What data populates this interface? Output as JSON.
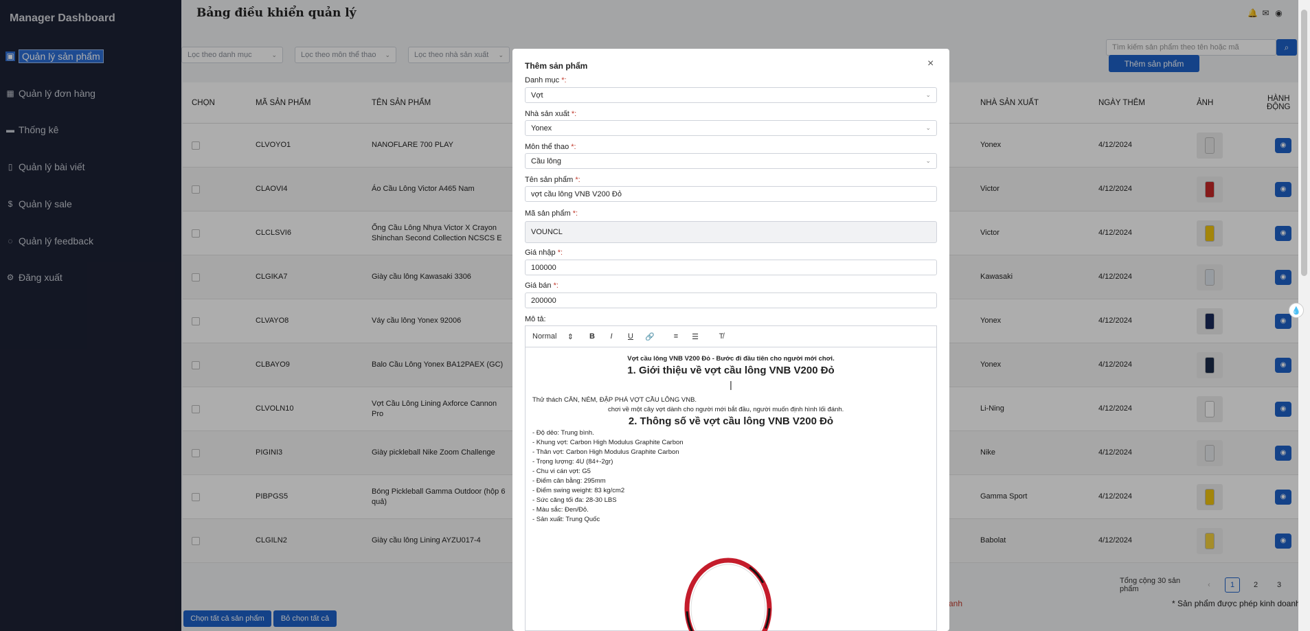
{
  "sidebar": {
    "brand": "Manager Dashboard",
    "items": [
      {
        "label": "Quản lý sản phẩm",
        "icon": "box-icon"
      },
      {
        "label": "Quản lý đơn hàng",
        "icon": "grid-icon"
      },
      {
        "label": "Thống kê",
        "icon": "chart-icon"
      },
      {
        "label": "Quản lý bài viết",
        "icon": "document-icon"
      },
      {
        "label": "Quản lý sale",
        "icon": "dollar-icon"
      },
      {
        "label": "Quản lý feedback",
        "icon": "comment-icon"
      },
      {
        "label": "Đăng xuất",
        "icon": "gear-icon"
      }
    ]
  },
  "header": {
    "title": "Bảng điều khiển quản lý"
  },
  "filters": {
    "category_placeholder": "Lọc theo danh mục",
    "sport_placeholder": "Lọc theo môn thể thao",
    "maker_placeholder": "Lọc theo nhà sản xuất"
  },
  "search": {
    "placeholder": "Tìm kiếm sản phẩm theo tên hoặc mã",
    "add_label": "Thêm sản phẩm"
  },
  "table": {
    "headers": {
      "select": "CHỌN",
      "code": "MÃ SẢN PHẨM",
      "name": "TÊN SẢN PHẨM",
      "maker": "NHÀ SẢN XUẤT",
      "date": "NGÀY THÊM",
      "image": "ẢNH",
      "action_1": "HÀNH",
      "action_2": "ĐỘNG"
    },
    "rows": [
      {
        "code": "CLVOYO1",
        "name": "NANOFLARE 700 PLAY",
        "maker": "Yonex",
        "date": "4/12/2024"
      },
      {
        "code": "CLAOVI4",
        "name": "Áo Cầu Lông Victor A465 Nam",
        "maker": "Victor",
        "date": "4/12/2024"
      },
      {
        "code": "CLCLSVI6",
        "name": "Ống Cầu Lông Nhựa Victor X Crayon Shinchan Second Collection NCSCS E",
        "maker": "Victor",
        "date": "4/12/2024"
      },
      {
        "code": "CLGIKA7",
        "name": "Giày cầu lông Kawasaki 3306",
        "maker": "Kawasaki",
        "date": "4/12/2024"
      },
      {
        "code": "CLVAYO8",
        "name": "Váy cầu lông Yonex 92006",
        "maker": "Yonex",
        "date": "4/12/2024"
      },
      {
        "code": "CLBAYO9",
        "name": "Balo Cầu Lông Yonex BA12PAEX (GC)",
        "maker": "Yonex",
        "date": "4/12/2024"
      },
      {
        "code": "CLVOLN10",
        "name": "Vợt Cầu Lông Lining Axforce Cannon Pro",
        "maker": "Li-Ning",
        "date": "4/12/2024"
      },
      {
        "code": "PIGINI3",
        "name": "Giày pickleball Nike Zoom Challenge",
        "maker": "Nike",
        "date": "4/12/2024"
      },
      {
        "code": "PIBPGS5",
        "name": "Bóng Pickleball Gamma Outdoor (hộp 6 quả)",
        "maker": "Gamma Sport",
        "date": "4/12/2024"
      },
      {
        "code": "CLGILN2",
        "name": "Giày cầu lông Lining AYZU017-4",
        "maker": "Babolat",
        "date": "4/12/2024"
      }
    ]
  },
  "pagination": {
    "total": "Tổng cộng 30 sản phẩm",
    "prev": "‹",
    "pages": [
      "1",
      "2",
      "3"
    ],
    "next": "›"
  },
  "notes": {
    "red": "anh",
    "right": "* Sản phẩm được phép kinh doanh"
  },
  "bottom": {
    "select_all": "Chọn tất cả sản phẩm",
    "deselect_all": "Bỏ chọn tất cả"
  },
  "modal": {
    "title": "Thêm sản phẩm",
    "close": "×",
    "required_mark": "*:",
    "category_label": "Danh mục ",
    "category_value": "Vợt",
    "maker_label": "Nhà sản xuất ",
    "maker_value": "Yonex",
    "sport_label": "Môn thể thao ",
    "sport_value": "Cầu lông",
    "name_label": "Tên sản phẩm ",
    "name_value": "vợt cầu lông VNB V200 Đỏ",
    "code_label": "Mã sản phẩm ",
    "code_value": "VOUNCL",
    "import_label": "Giá nhập ",
    "import_value": "100000",
    "sale_label": "Giá bán ",
    "sale_value": "200000",
    "desc_label": "Mô tả:",
    "editor": {
      "format": "Normal",
      "intro": "Vợt cầu lông VNB V200 Đỏ - Bước đi đầu tiên cho người mới chơi.",
      "h1": "1. Giới thiệu về vợt cầu lông VNB V200 Đỏ",
      "caret": "|",
      "p1": "Thử thách CĂN, NÉM, ĐẬP PHÁ VỢT CẦU LÔNG VNB.",
      "p2": "chơi về một cây vợt dành cho người mới bắt đầu, người muốn định hình lối đánh.",
      "h2": "2. Thông số về vợt cầu lông VNB V200 Đỏ",
      "specs": [
        "- Độ dẻo: Trung bình.",
        "- Khung vợt: Carbon High Modulus Graphite Carbon",
        "- Thân vợt: Carbon High Modulus Graphite Carbon",
        "- Trọng lượng: 4U (84+-2gr)",
        "- Chu vi cán vợt: G5",
        "- Điểm cân bằng: 295mm",
        "- Điểm swing weight: 83 kg/cm2",
        "- Sức căng tối đa: 28-30 LBS",
        "- Màu sắc: Đen/Đỏ.",
        "- Sản xuất: Trung Quốc"
      ]
    }
  },
  "colors": {
    "sidebar": "#1d2235",
    "primary": "#1e62c9",
    "required": "#c0392b"
  }
}
